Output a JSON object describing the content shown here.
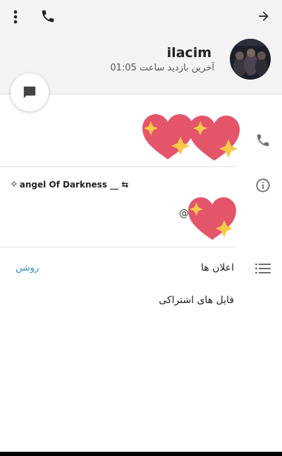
{
  "header": {
    "contact_name": "ilacim",
    "last_seen": "آخرین بازدید ساعت 01:05",
    "icons": {
      "more": "more-vert-icon",
      "call": "phone-icon",
      "back": "arrow-forward-icon"
    }
  },
  "fab": {
    "icon": "message-icon"
  },
  "phone_row": {
    "icon": "phone-icon",
    "value_emoji": "💖💖"
  },
  "bio_row": {
    "icon": "info-icon",
    "line1_prefix": "✧ ",
    "line1_text": "angel Of Darkness __ ⇆",
    "line2_prefix": "@",
    "emoji": "💖"
  },
  "notifications_row": {
    "icon": "list-icon",
    "label": "اعلان ها",
    "value": "روشن"
  },
  "shared_files_row": {
    "label": "فایل های اشتراکی"
  },
  "colors": {
    "accent": "#2a8bd4",
    "heart": "#e4556a",
    "sparkle": "#f7c948"
  }
}
